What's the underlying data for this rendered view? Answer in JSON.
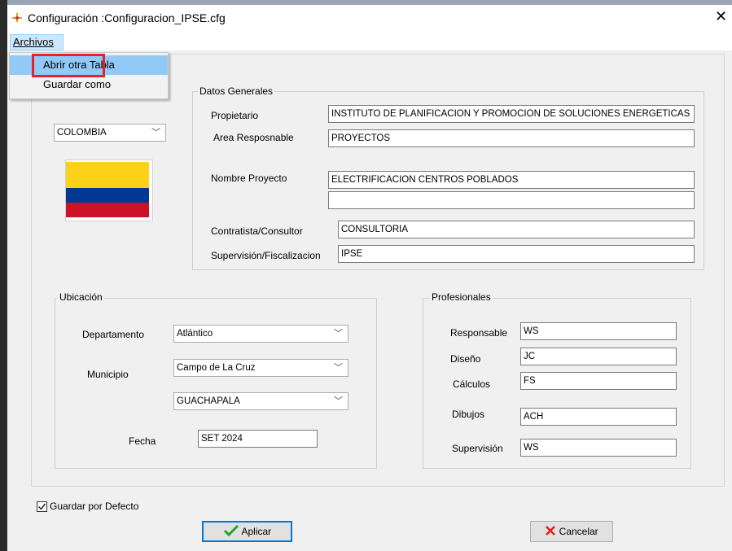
{
  "window": {
    "title": "Configuración :Configuracion_IPSE.cfg",
    "close_glyph": "✕"
  },
  "menu": {
    "archivos": "Archivos",
    "items": [
      "Abrir otra Tabla",
      "Guardar como"
    ]
  },
  "country": {
    "selected": "COLOMBIA",
    "flag_colors": [
      "#fcd116",
      "#003893",
      "#ce1126"
    ]
  },
  "datos_generales": {
    "legend": "Datos Generales",
    "propietario_label": "Propietario",
    "propietario_value": "INSTITUTO DE PLANIFICACION Y PROMOCION DE SOLUCIONES ENERGETICAS",
    "area_label": "Area Resposnable",
    "area_value": "PROYECTOS",
    "nombre_label": "Nombre Proyecto",
    "nombre_value": "ELECTRIFICACION CENTROS POBLADOS",
    "nombre_value2": "",
    "contratista_label": "Contratista/Consultor",
    "contratista_value": "CONSULTORIA",
    "supervision_label": "Supervisión/Fiscalizacion",
    "supervision_value": "IPSE"
  },
  "ubicacion": {
    "legend": "Ubicación",
    "departamento_label": "Departamento",
    "departamento_value": "Atlántico",
    "municipio_label": "Municipio",
    "municipio_value": "Campo de La Cruz",
    "localidad_value": "GUACHAPALA",
    "fecha_label": "Fecha",
    "fecha_value": "SET 2024"
  },
  "profesionales": {
    "legend": "Profesionales",
    "responsable_label": "Responsable",
    "responsable_value": "WS",
    "diseno_label": "Diseño",
    "diseno_value": "JC",
    "calculos_label": "Cálculos",
    "calculos_value": "FS",
    "dibujos_label": "Dibujos",
    "dibujos_value": "ACH",
    "supervision_label": "Supervisión",
    "supervision_value": "WS"
  },
  "footer": {
    "guardar_defecto_label": "Guardar por Defecto",
    "guardar_defecto_checked": true,
    "aplicar_label": "Aplicar",
    "cancelar_label": "Cancelar",
    "accent_check": "#22a52c",
    "accent_cancel": "#e02020"
  },
  "icons": [
    "app-icon",
    "close-icon",
    "chevron-down-icon",
    "checkmark-icon",
    "cancel-x-icon"
  ]
}
